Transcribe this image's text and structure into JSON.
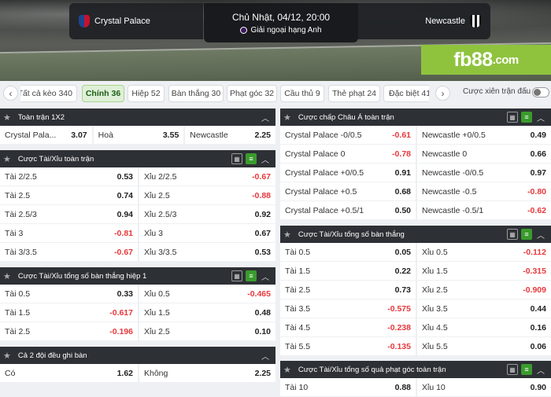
{
  "match": {
    "home": "Crystal Palace",
    "away": "Newcastle",
    "datetime": "Chủ Nhật, 04/12, 20:00",
    "league": "Giải ngoại hạng Anh"
  },
  "brand": {
    "logo_main": "fb88",
    "logo_suffix": ".com",
    "color": "#8fc33e"
  },
  "tabs": [
    "Tất cả kèo 340",
    "Chính 36",
    "Hiệp 52",
    "Bàn thắng 30",
    "Phạt góc 32",
    "Cầu thủ 9",
    "Thẻ phạt 24",
    "Đặc biệt 41"
  ],
  "active_tab": 1,
  "combo_label": "Cược xiên trận đấu",
  "panels": {
    "p1x2": {
      "title": "Toàn trận 1X2",
      "rows": [
        [
          [
            "Crystal Pala...",
            "3.07"
          ],
          [
            "Hoà",
            "3.55"
          ],
          [
            "Newcastle",
            "2.25"
          ]
        ]
      ]
    },
    "ou_full": {
      "title": "Cược Tài/Xỉu toàn trận",
      "rows": [
        [
          [
            "Tài 2/2.5",
            "0.53"
          ],
          [
            "Xỉu 2/2.5",
            "-0.67"
          ]
        ],
        [
          [
            "Tài 2.5",
            "0.74"
          ],
          [
            "Xỉu 2.5",
            "-0.88"
          ]
        ],
        [
          [
            "Tài 2.5/3",
            "0.94"
          ],
          [
            "Xỉu 2.5/3",
            "0.92"
          ]
        ],
        [
          [
            "Tài 3",
            "-0.81"
          ],
          [
            "Xỉu 3",
            "0.67"
          ]
        ],
        [
          [
            "Tài 3/3.5",
            "-0.67"
          ],
          [
            "Xỉu 3/3.5",
            "0.53"
          ]
        ]
      ]
    },
    "ou_h1": {
      "title": "Cược Tài/Xỉu tổng số bàn thắng hiệp 1",
      "rows": [
        [
          [
            "Tài 0.5",
            "0.33"
          ],
          [
            "Xỉu 0.5",
            "-0.465"
          ]
        ],
        [
          [
            "Tài 1.5",
            "-0.617"
          ],
          [
            "Xỉu 1.5",
            "0.48"
          ]
        ],
        [
          [
            "Tài 2.5",
            "-0.196"
          ],
          [
            "Xỉu 2.5",
            "0.10"
          ]
        ]
      ]
    },
    "btts": {
      "title": "Cả 2 đội đều ghi bàn",
      "rows": [
        [
          [
            "Có",
            "1.62"
          ],
          [
            "Không",
            "2.25"
          ]
        ]
      ]
    },
    "ah": {
      "title": "Cược chấp Châu Á toàn trận",
      "rows": [
        [
          [
            "Crystal Palace -0/0.5",
            "-0.61"
          ],
          [
            "Newcastle +0/0.5",
            "0.49"
          ]
        ],
        [
          [
            "Crystal Palace 0",
            "-0.78"
          ],
          [
            "Newcastle 0",
            "0.66"
          ]
        ],
        [
          [
            "Crystal Palace +0/0.5",
            "0.91"
          ],
          [
            "Newcastle -0/0.5",
            "0.97"
          ]
        ],
        [
          [
            "Crystal Palace +0.5",
            "0.68"
          ],
          [
            "Newcastle -0.5",
            "-0.80"
          ]
        ],
        [
          [
            "Crystal Palace +0.5/1",
            "0.50"
          ],
          [
            "Newcastle -0.5/1",
            "-0.62"
          ]
        ]
      ]
    },
    "ou_goals": {
      "title": "Cược Tài/Xỉu tổng số bàn thắng",
      "rows": [
        [
          [
            "Tài 0.5",
            "0.05"
          ],
          [
            "Xỉu 0.5",
            "-0.112"
          ]
        ],
        [
          [
            "Tài 1.5",
            "0.22"
          ],
          [
            "Xỉu 1.5",
            "-0.315"
          ]
        ],
        [
          [
            "Tài 2.5",
            "0.73"
          ],
          [
            "Xỉu 2.5",
            "-0.909"
          ]
        ],
        [
          [
            "Tài 3.5",
            "-0.575"
          ],
          [
            "Xỉu 3.5",
            "0.44"
          ]
        ],
        [
          [
            "Tài 4.5",
            "-0.238"
          ],
          [
            "Xỉu 4.5",
            "0.16"
          ]
        ],
        [
          [
            "Tài 5.5",
            "-0.135"
          ],
          [
            "Xỉu 5.5",
            "0.06"
          ]
        ]
      ]
    },
    "ou_corners": {
      "title": "Cược Tài/Xỉu tổng số quả phạt góc toàn trận",
      "rows": [
        [
          [
            "Tài 10",
            "0.88"
          ],
          [
            "Xỉu 10",
            "0.90"
          ]
        ]
      ]
    }
  },
  "colors": {
    "negative": "#e8383c",
    "active_tab": "#dff0d8",
    "header": "#2d3035"
  }
}
